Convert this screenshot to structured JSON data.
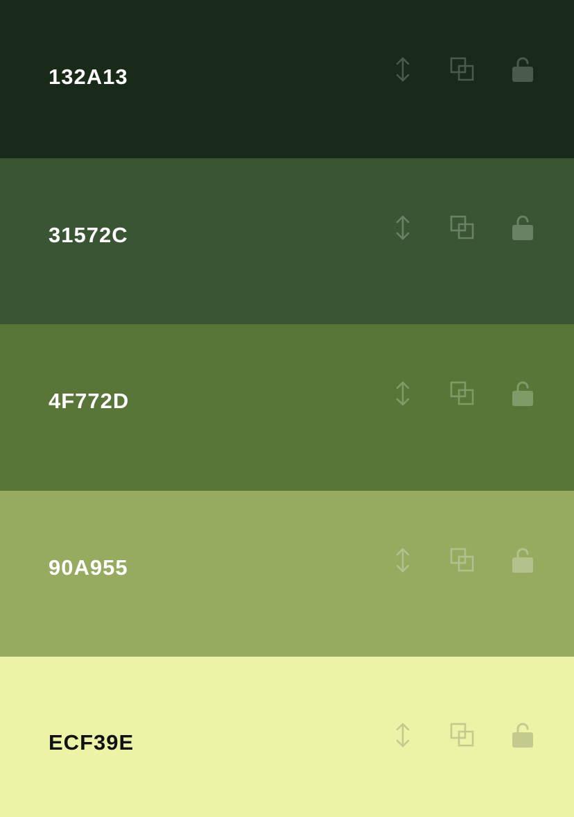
{
  "swatches": [
    {
      "hex": "132A13",
      "background": "#1A2A18",
      "text_color": "#FFFFFF",
      "icon_color": "#4B5B4A"
    },
    {
      "hex": "31572C",
      "background": "#3A5533",
      "text_color": "#FFFFFF",
      "icon_color": "#6B8164"
    },
    {
      "hex": "4F772D",
      "background": "#597638",
      "text_color": "#FFFFFF",
      "icon_color": "#809A68"
    },
    {
      "hex": "90A955",
      "background": "#96AA60",
      "text_color": "#FFFFFF",
      "icon_color": "#B3C28D"
    },
    {
      "hex": "ECF39E",
      "background": "#ECF2A6",
      "text_color": "#111111",
      "icon_color": "#C4CA8D"
    }
  ],
  "tools": {
    "move": "move-vertical-icon",
    "copy": "copy-icon",
    "lock": "unlocked-padlock-icon"
  }
}
